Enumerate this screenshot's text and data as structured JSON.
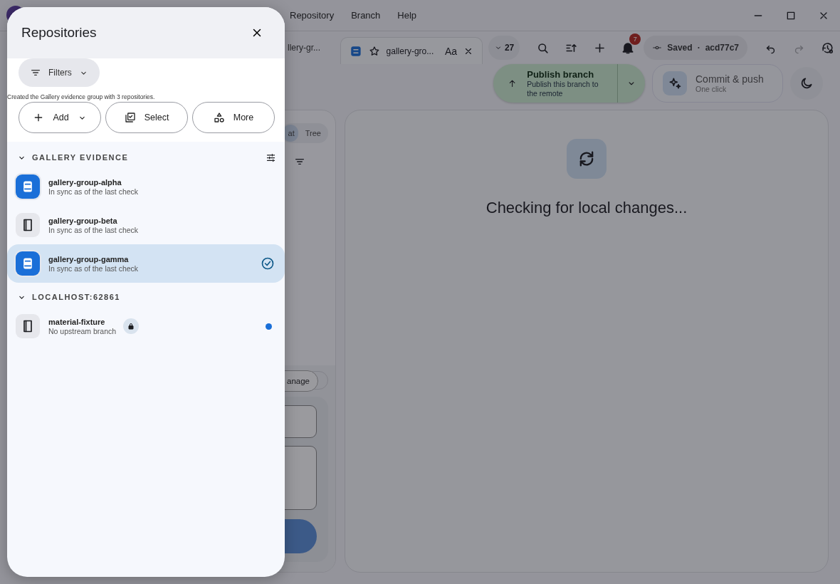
{
  "window": {
    "menu": [
      {
        "label": "Repository"
      },
      {
        "label": "Branch"
      },
      {
        "label": "Help"
      }
    ]
  },
  "toolbar": {
    "breadcrumb": "llery-gr...",
    "tab": {
      "label": "gallery-gro...",
      "font_button": "Aa"
    },
    "count": "27",
    "notifications": "7",
    "save_status": {
      "label": "Saved",
      "separator": "·",
      "commit": "acd77c7"
    },
    "redo": {
      "disabled": true
    }
  },
  "actions": {
    "publish": {
      "title": "Publish branch",
      "subtitle": "Publish this branch to the remote"
    },
    "commit": {
      "title": "Commit & push",
      "subtitle": "One click"
    }
  },
  "changes_panel": {
    "view_toggle": [
      {
        "label": "at",
        "selected": true
      },
      {
        "label": "Tree",
        "selected": false
      }
    ],
    "manage": "anage"
  },
  "main": {
    "message": "Checking for local changes..."
  },
  "drawer": {
    "title": "Repositories",
    "filter_label": "Filters",
    "notice": "Created the Gallery evidence group with 3 repositories.",
    "buttons": [
      {
        "label": "Add",
        "kind": "add"
      },
      {
        "label": "Select",
        "kind": "select"
      },
      {
        "label": "More",
        "kind": "more"
      }
    ],
    "groups": [
      {
        "name": "GALLERY EVIDENCE",
        "expanded": true,
        "options_button": true,
        "items": [
          {
            "name": "gallery-group-alpha",
            "status": "In sync as of the last check",
            "accent": true,
            "selected": false,
            "locked": false,
            "indicator": false
          },
          {
            "name": "gallery-group-beta",
            "status": "In sync as of the last check",
            "accent": false,
            "selected": false,
            "locked": false,
            "indicator": false
          },
          {
            "name": "gallery-group-gamma",
            "status": "In sync as of the last check",
            "accent": true,
            "selected": true,
            "locked": false,
            "indicator": false
          }
        ]
      },
      {
        "name": "LOCALHOST:62861",
        "expanded": true,
        "options_button": false,
        "items": [
          {
            "name": "material-fixture",
            "status": "No upstream branch",
            "accent": false,
            "selected": false,
            "locked": true,
            "indicator": true
          }
        ]
      }
    ]
  }
}
